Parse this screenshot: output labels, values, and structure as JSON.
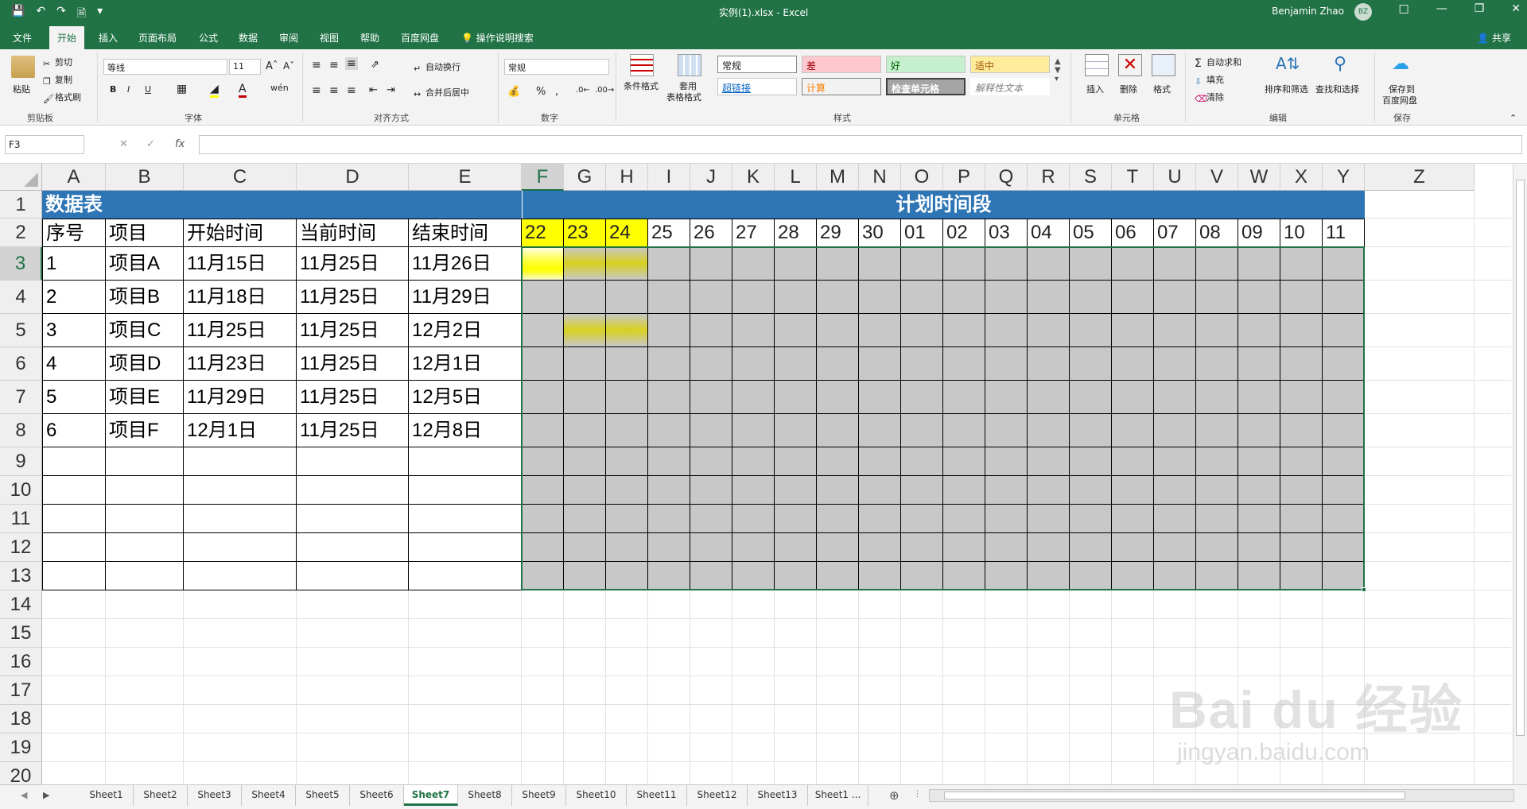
{
  "window": {
    "title": "实例(1).xlsx  -  Excel",
    "user": "Benjamin Zhao",
    "user_initials": "BZ",
    "qat": [
      "save-icon",
      "undo-icon",
      "redo-icon",
      "new-doc-icon",
      "customize-icon"
    ]
  },
  "tabs": [
    "文件",
    "开始",
    "插入",
    "页面布局",
    "公式",
    "数据",
    "审阅",
    "视图",
    "帮助",
    "百度网盘",
    "操作说明搜索"
  ],
  "active_tab": "开始",
  "share_label": "共享",
  "ribbon": {
    "clipboard": {
      "label": "剪贴板",
      "paste": "粘贴",
      "cut": "剪切",
      "copy": "复制",
      "format_painter": "格式刷"
    },
    "font": {
      "label": "字体",
      "name": "等线",
      "size": "11",
      "bold": "B",
      "italic": "I",
      "underline": "U"
    },
    "alignment": {
      "label": "对齐方式",
      "wrap": "自动换行",
      "merge": "合并后居中"
    },
    "number": {
      "label": "数字",
      "format": "常规"
    },
    "styles": {
      "label": "样式",
      "conditional": "条件格式",
      "table_format": "套用\n表格格式",
      "table_format_l1": "套用",
      "table_format_l2": "表格格式",
      "boxes": [
        "常规",
        "差",
        "好",
        "适中",
        "超链接",
        "计算",
        "检查单元格",
        "解释性文本"
      ]
    },
    "cells": {
      "label": "单元格",
      "insert": "插入",
      "delete": "删除",
      "format": "格式"
    },
    "editing": {
      "label": "编辑",
      "autosum": "自动求和",
      "fill": "填充",
      "clear": "清除",
      "sort": "排序和筛选",
      "find": "查找和选择"
    },
    "save": {
      "label": "保存",
      "save_l1": "保存到",
      "save_l2": "百度网盘"
    }
  },
  "formula_bar": {
    "name_box": "F3",
    "formula": ""
  },
  "columns": [
    "A",
    "B",
    "C",
    "D",
    "E",
    "F",
    "G",
    "H",
    "I",
    "J",
    "K",
    "L",
    "M",
    "N",
    "O",
    "P",
    "Q",
    "R",
    "S",
    "T",
    "U",
    "V",
    "W",
    "X",
    "Y",
    "Z"
  ],
  "rows": [
    "1",
    "2",
    "3",
    "4",
    "5",
    "6",
    "7",
    "8",
    "9",
    "10",
    "11",
    "12",
    "13",
    "14",
    "15",
    "16",
    "17",
    "18",
    "19",
    "20"
  ],
  "sheet": {
    "title_left": "数据表",
    "title_right": "计划时间段",
    "headers": [
      "序号",
      "项目",
      "开始时间",
      "当前时间",
      "结束时间"
    ],
    "data": [
      [
        "1",
        "项目A",
        "11月15日",
        "11月25日",
        "11月26日"
      ],
      [
        "2",
        "项目B",
        "11月18日",
        "11月25日",
        "11月29日"
      ],
      [
        "3",
        "项目C",
        "11月25日",
        "11月25日",
        "12月2日"
      ],
      [
        "4",
        "项目D",
        "11月23日",
        "11月25日",
        "12月1日"
      ],
      [
        "5",
        "项目E",
        "11月29日",
        "11月25日",
        "12月5日"
      ],
      [
        "6",
        "项目F",
        "12月1日",
        "11月25日",
        "12月8日"
      ]
    ],
    "dates": [
      "22",
      "23",
      "24",
      "25",
      "26",
      "27",
      "28",
      "29",
      "30",
      "01",
      "02",
      "03",
      "04",
      "05",
      "06",
      "07",
      "08",
      "09",
      "10",
      "11"
    ]
  },
  "sheet_tabs": [
    "Sheet1",
    "Sheet2",
    "Sheet3",
    "Sheet4",
    "Sheet5",
    "Sheet6",
    "Sheet7",
    "Sheet8",
    "Sheet9",
    "Sheet10",
    "Sheet11",
    "Sheet12",
    "Sheet13",
    "Sheet1 ..."
  ],
  "active_sheet": "Sheet7",
  "watermark": {
    "main": "Bai du 经验",
    "sub": "jingyan.baidu.com"
  },
  "colors": {
    "excel_green": "#217346",
    "band_blue": "#2e75b6",
    "gantt_gray": "#c8c8c8",
    "highlight_yellow": "#ffff00"
  }
}
